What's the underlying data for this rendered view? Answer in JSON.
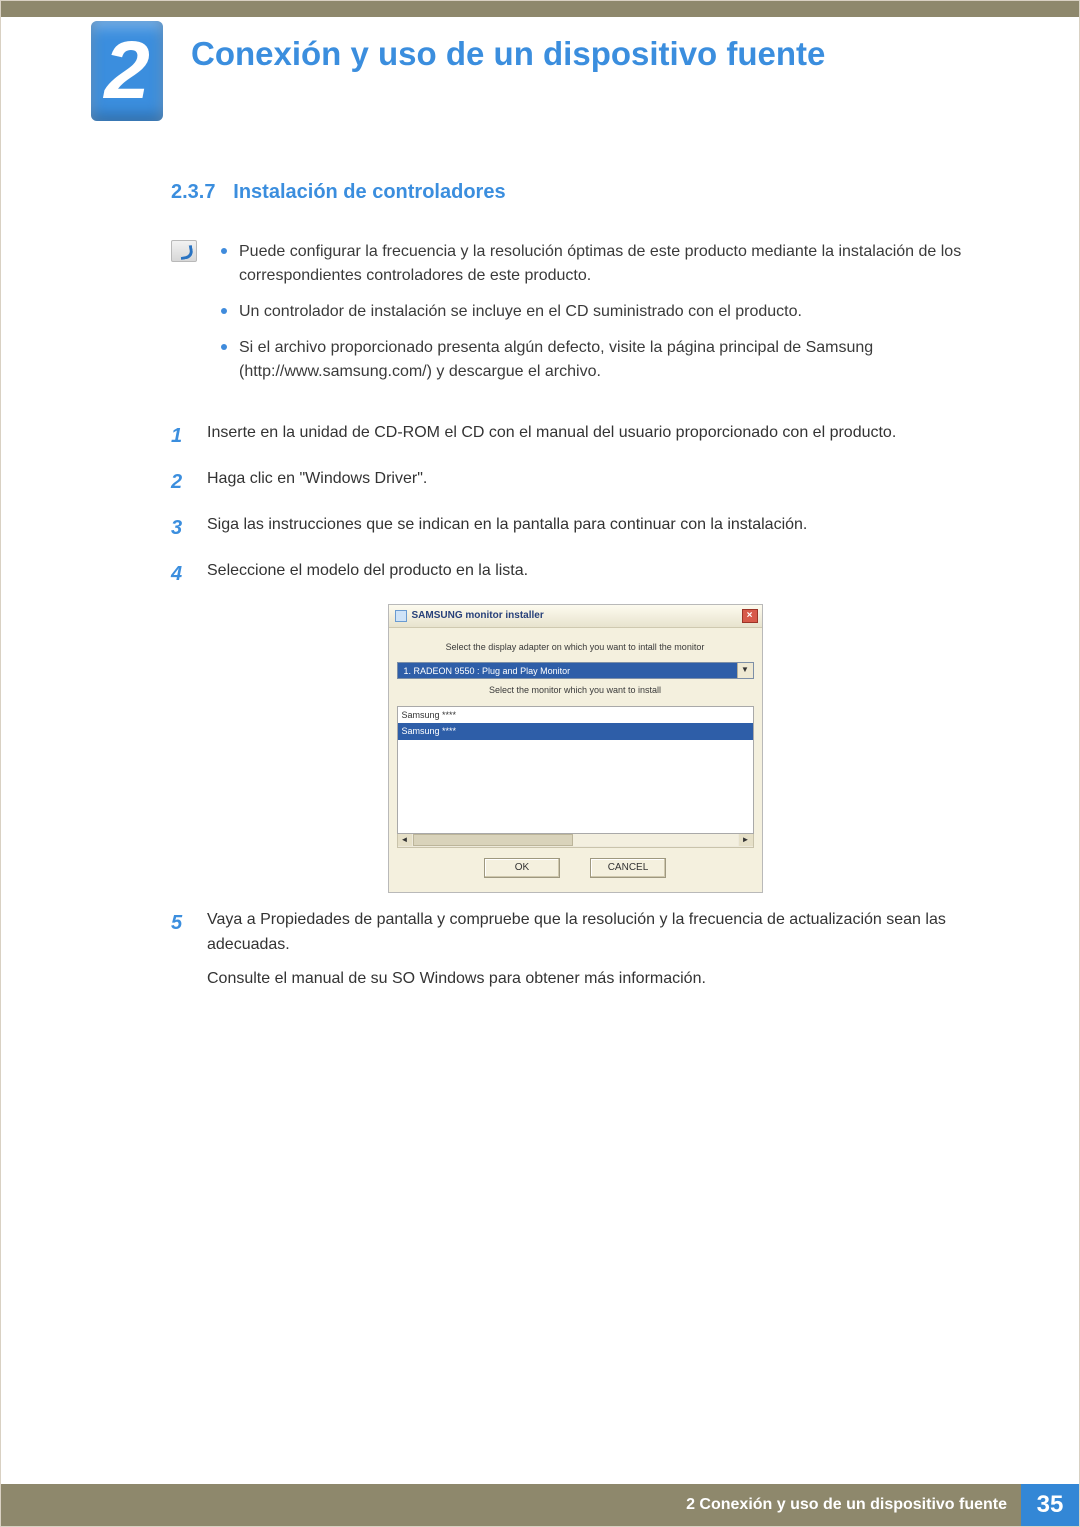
{
  "header": {
    "chapter_number": "2",
    "chapter_title": "Conexión y uso de un dispositivo fuente"
  },
  "section": {
    "number": "2.3.7",
    "title": "Instalación de controladores"
  },
  "info_bullets": [
    "Puede configurar la frecuencia y la resolución óptimas de este producto mediante la instalación de los correspondientes controladores de este producto.",
    "Un controlador de instalación se incluye en el CD suministrado con el producto.",
    "Si el archivo proporcionado presenta algún defecto, visite la página principal de Samsung (http://www.samsung.com/) y descargue el archivo."
  ],
  "steps": [
    {
      "n": "1",
      "text": "Inserte en la unidad de CD-ROM el CD con el manual del usuario proporcionado con el producto."
    },
    {
      "n": "2",
      "text": "Haga clic en \"Windows Driver\"."
    },
    {
      "n": "3",
      "text": "Siga las instrucciones que se indican en la pantalla para continuar con la instalación."
    },
    {
      "n": "4",
      "text": "Seleccione el modelo del producto en la lista."
    },
    {
      "n": "5",
      "text": "Vaya a Propiedades de pantalla y compruebe que la resolución y la frecuencia de actualización sean las adecuadas.",
      "note": "Consulte el manual de su SO Windows para obtener más información."
    }
  ],
  "installer": {
    "title": "SAMSUNG monitor installer",
    "label_adapter": "Select the display adapter on which you want to intall the monitor",
    "adapter_value": "1. RADEON 9550 : Plug and Play Monitor",
    "label_monitor": "Select the monitor which you want to install",
    "list_items": [
      "Samsung ****",
      "Samsung ****"
    ],
    "ok": "OK",
    "cancel": "CANCEL",
    "close_glyph": "×"
  },
  "footer": {
    "text": "2 Conexión y uso de un dispositivo fuente",
    "page": "35"
  }
}
